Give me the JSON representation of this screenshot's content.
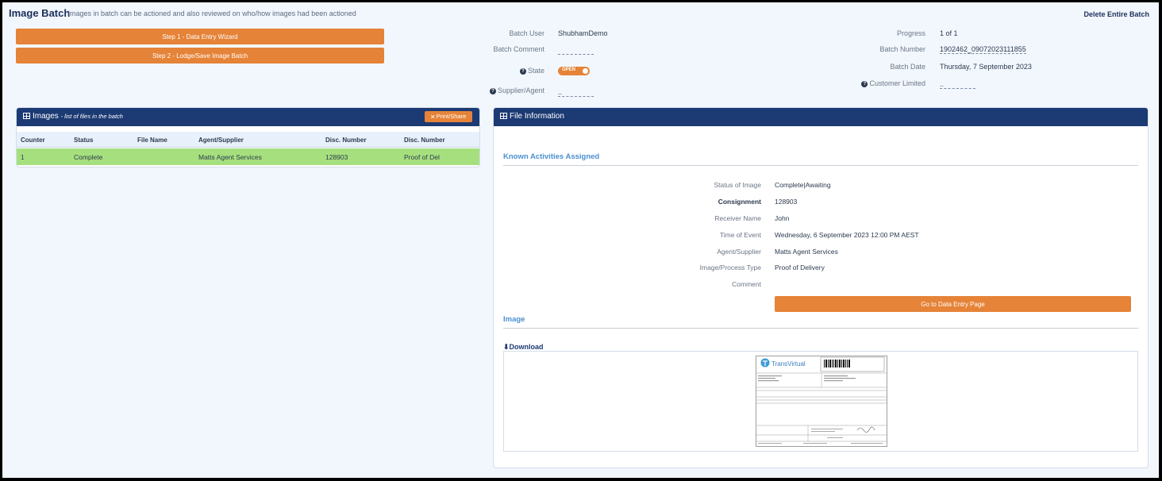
{
  "header": {
    "title": "Image Batch",
    "subtitle": "images in batch can be actioned and also reviewed on who/how images had been actioned",
    "delete_label": "Delete Entire Batch"
  },
  "actions": {
    "step1": "Step 1 - Data Entry Wizard",
    "step2": "Step 2 - Lodge/Save Image Batch"
  },
  "batch_info": {
    "batch_user_label": "Batch User",
    "batch_user": "ShubhamDemo",
    "batch_comment_label": "Batch Comment",
    "batch_comment": "",
    "state_label": "State",
    "state_value": "OPEN",
    "supplier_label": "Supplier/Agent",
    "supplier_value": "..",
    "progress_label": "Progress",
    "progress": "1 of 1",
    "batch_number_label": "Batch Number",
    "batch_number": "1902462_09072023111855",
    "batch_date_label": "Batch Date",
    "batch_date": "Thursday, 7 September 2023",
    "customer_label": "Customer Limited",
    "customer_value": ".."
  },
  "images_panel": {
    "title": "Images",
    "subtitle": "- list of files in the batch",
    "print_label": "Print/Share",
    "columns": [
      "Counter",
      "Status",
      "File Name",
      "Agent/Supplier",
      "Disc. Number",
      "Disc. Number"
    ],
    "rows": [
      {
        "counter": "1",
        "status": "Complete",
        "file_name": "",
        "agent": "Matts Agent Services",
        "disc1": "128903",
        "disc2": "Proof of Del"
      }
    ]
  },
  "file_panel": {
    "title": "File Information",
    "known_title": "Known Activities Assigned",
    "status_label": "Status of Image",
    "status_value": "Complete|Awaiting",
    "consignment_label": "Consignment",
    "consignment_value": "128903",
    "receiver_label": "Receiver Name",
    "receiver_value": "John",
    "time_label": "Time of Event",
    "time_value": "Wednesday, 6 September 2023 12:00 PM AEST",
    "agent_label": "Agent/Supplier",
    "agent_value": "Matts Agent Services",
    "type_label": "Image/Process Type",
    "type_value": "Proof of Delivery",
    "comment_label": "Comment",
    "comment_value": "",
    "go_button": "Go to Data Entry Page",
    "image_title": "Image",
    "download_label": "Download",
    "doc_brand": "TransVirtual"
  },
  "colors": {
    "accent": "#e58338",
    "navy": "#1c3a73",
    "row_highlight": "#a6e07e",
    "section_blue": "#4a8fd0"
  }
}
